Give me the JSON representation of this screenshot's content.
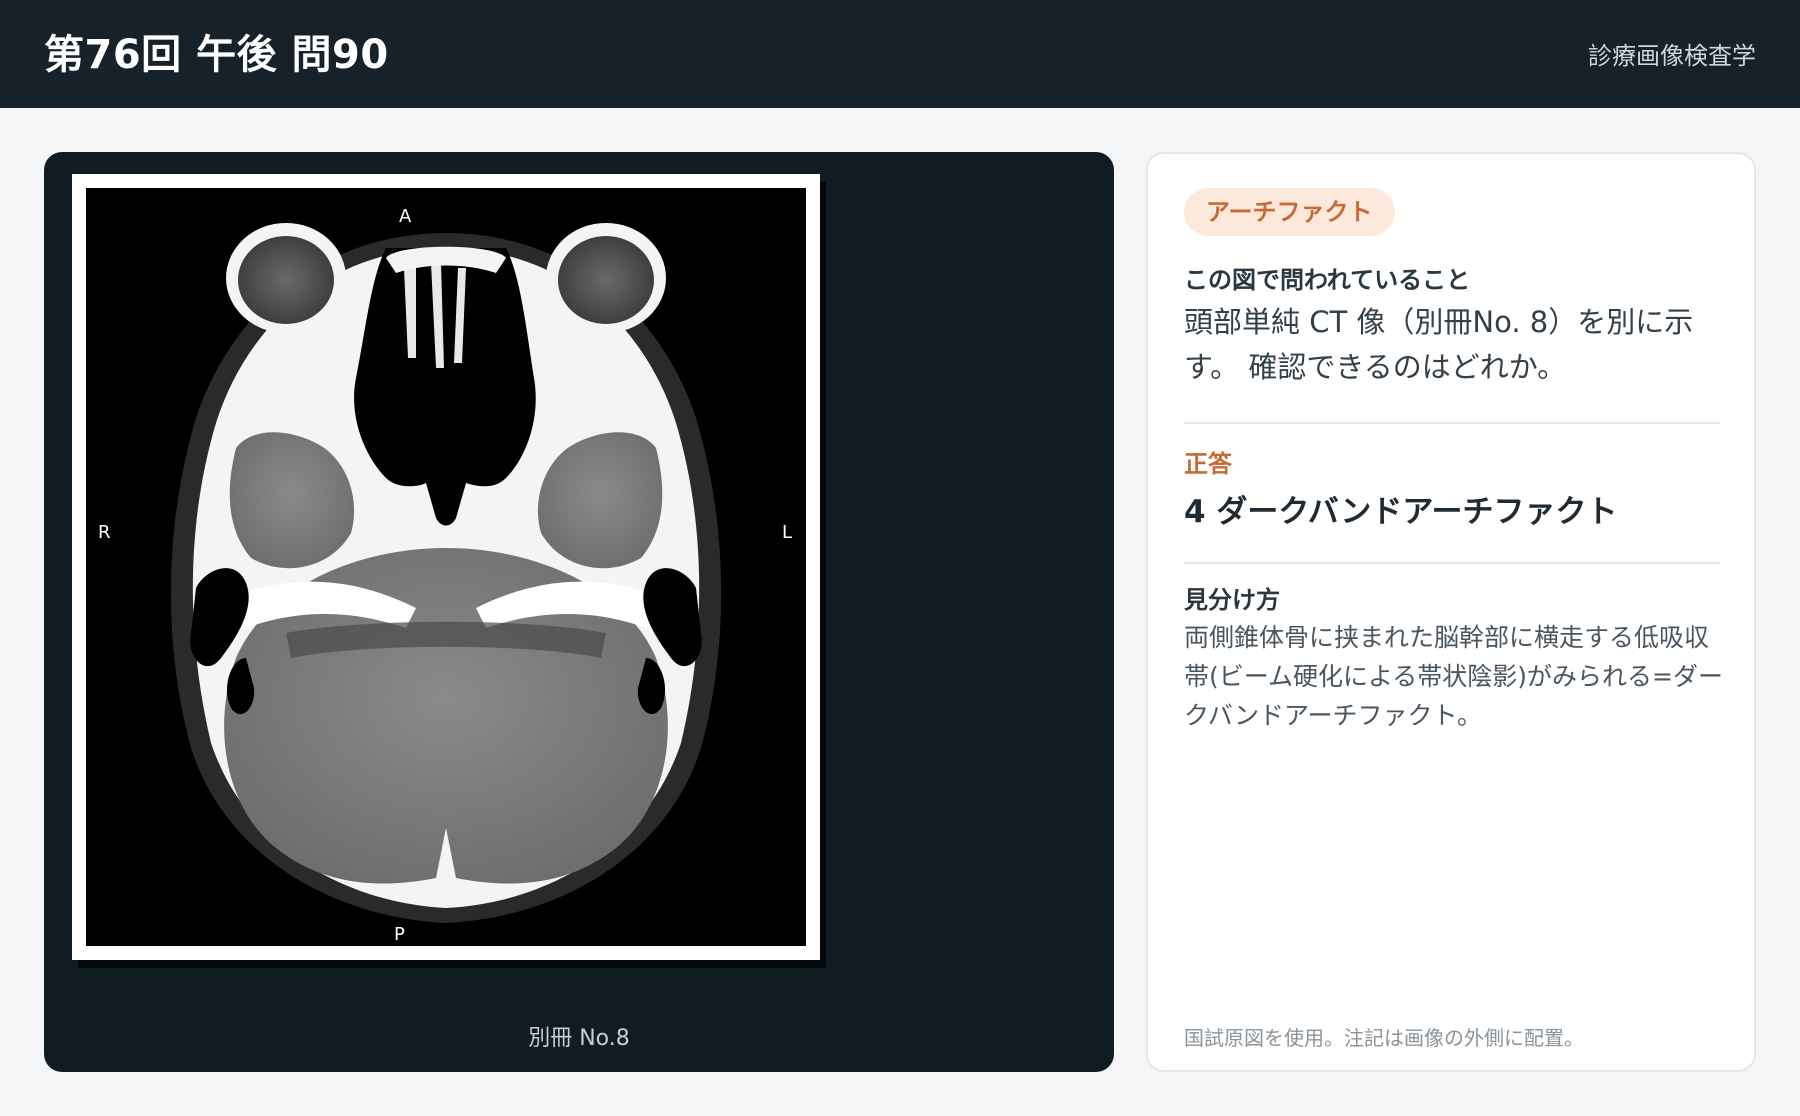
{
  "header": {
    "title": "第76回 午後 問90",
    "subject": "診療画像検査学"
  },
  "viewer": {
    "orientation": {
      "anterior": "A",
      "posterior": "P",
      "right": "R",
      "left": "L"
    },
    "caption": "別冊 No.8"
  },
  "panel": {
    "badge": "アーチファクト",
    "question_label": "この図で問われていること",
    "question_text": "頭部単純 CT 像（別冊No. 8）を別に示す。 確認できるのはどれか。",
    "answer_label": "正答",
    "answer_text": "4 ダークバンドアーチファクト",
    "explain_label": "見分け方",
    "explain_text": "両側錐体骨に挟まれた脳幹部に横走する低吸収帯(ビーム硬化による帯状陰影)がみられる=ダークバンドアーチファクト。",
    "footnote": "国試原図を使用。注記は画像の外側に配置。"
  },
  "colors": {
    "header_bg": "#16212a",
    "accent": "#c86a35",
    "badge_bg": "#fde9dc"
  }
}
